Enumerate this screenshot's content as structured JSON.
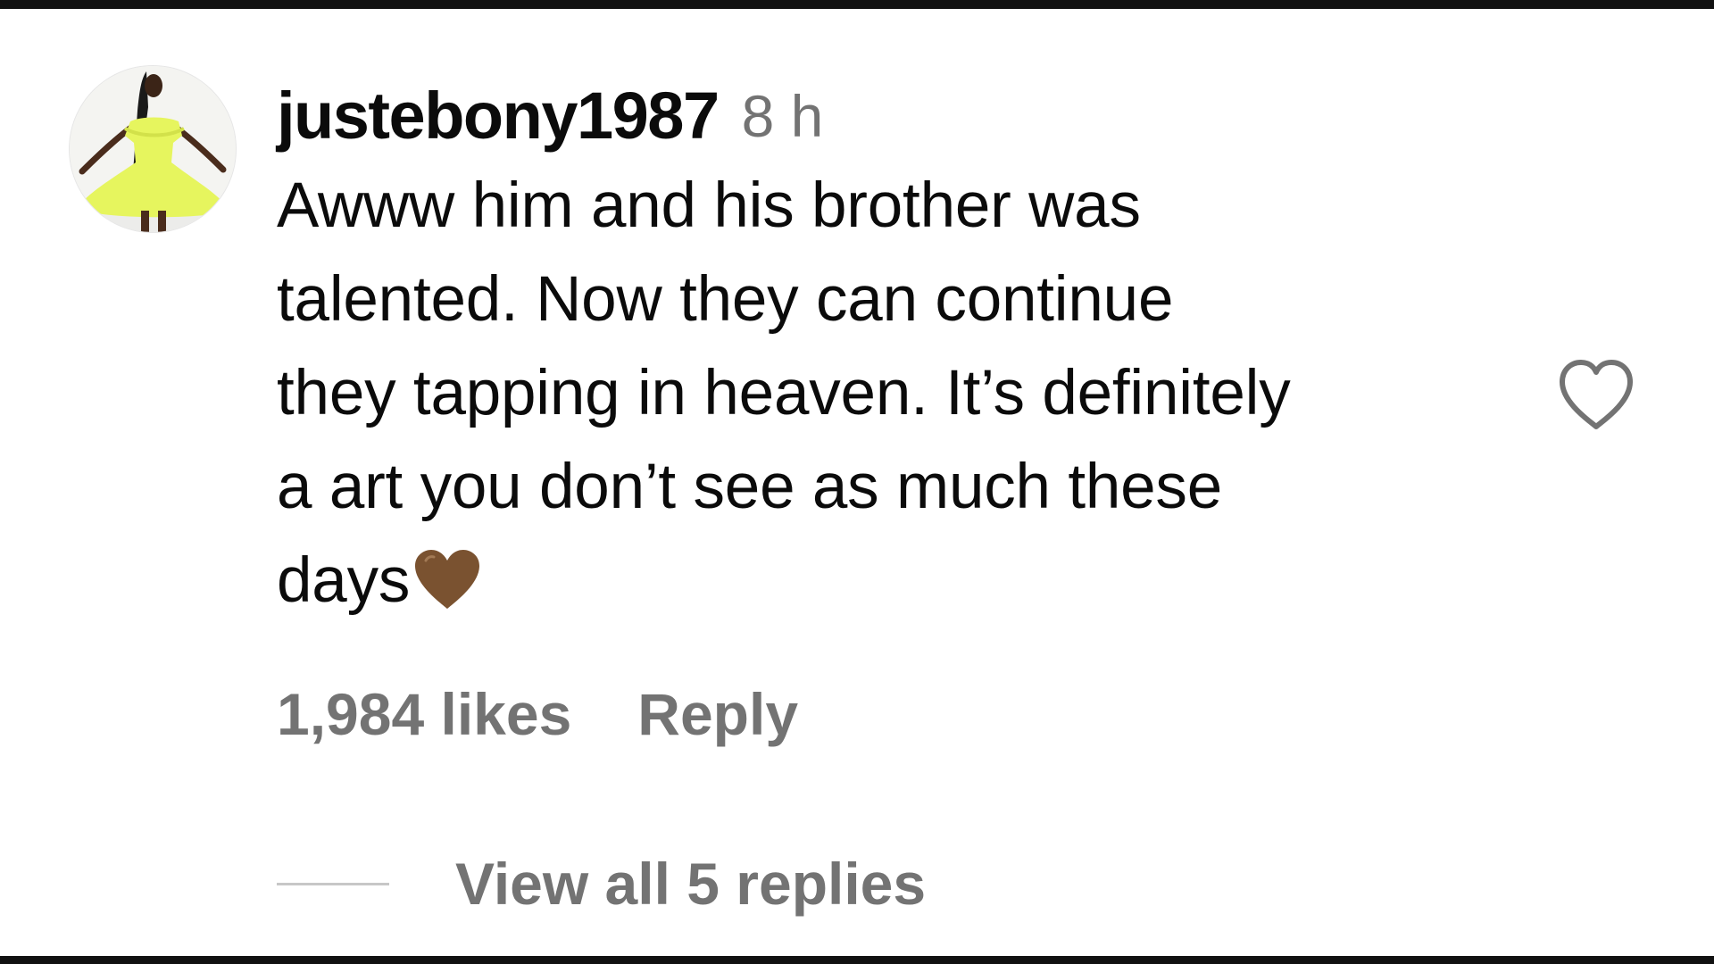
{
  "comment": {
    "username": "justebony1987",
    "timestamp": "8 h",
    "text_lines": [
      "Awww him and his brother was",
      "talented. Now they can continue",
      "they tapping in heaven. It’s definitely",
      "a art you don’t see as much these",
      "days"
    ],
    "text_emoji": "brown-heart-icon",
    "likes": "1,984 likes",
    "reply_label": "Reply",
    "view_replies_label": "View all 5 replies",
    "like_icon": "heart-outline-icon",
    "avatar_icon": "profile-avatar"
  },
  "colors": {
    "text_primary": "#0b0b0b",
    "text_secondary": "#737373",
    "divider": "#c7c7c7",
    "brown_heart": "#7a5230",
    "avatar_dress": "#e8f566",
    "frame": "#111111"
  }
}
